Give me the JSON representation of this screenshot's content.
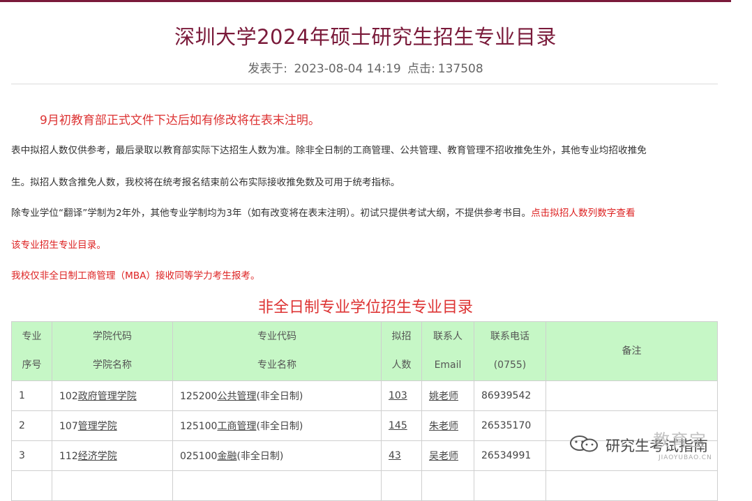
{
  "article": {
    "title": "深圳大学2024年硕士研究生招生专业目录",
    "meta_published_label": "发表于:",
    "meta_date": "2023-08-04 14:19",
    "meta_clicks_label": "点击:",
    "meta_clicks": "137508"
  },
  "notice": "9月初教育部正式文件下达后如有修改将在表末注明。",
  "paragraphs": {
    "p1": "表中拟招人数仅供参考，最后录取以教育部实际下达招生人数为准。除非全日制的工商管理、公共管理、教育管理不招收推免生外，其他专业均招收推免",
    "p2": "生。拟招人数含推免人数，我校将在统考报名结束前公布实际接收推免数及可用于统考指标。",
    "p3_normal": "除专业学位“翻译”学制为2年外，其他专业学制均为3年（如有改变将在表末注明）。初试只提供考试大纲，不提供参考书目。",
    "p3_red": "点击拟招人数列数字查看",
    "p4_red": "该专业招生专业目录。",
    "p5_red": "我校仅非全日制工商管理（MBA）接收同等学力考生报考。"
  },
  "section_title": "非全日制专业学位招生专业目录",
  "table": {
    "headers": {
      "seq_1": "专业",
      "seq_2": "序号",
      "college_1": "学院代码",
      "college_2": "学院名称",
      "major_1": "专业代码",
      "major_2": "专业名称",
      "plan_1": "拟招",
      "plan_2": "人数",
      "contact_1": "联系人",
      "contact_2": "Email",
      "phone_1": "联系电话",
      "phone_2": "(0755)",
      "remark": "备注"
    },
    "rows": [
      {
        "seq": "1",
        "college_code": "102",
        "college_name": "政府管理学院",
        "major_code": "125200",
        "major_name": "公共管理",
        "major_type": "(非全日制)",
        "plan": "103",
        "contact": "姚老师",
        "phone": "86939542",
        "remark": ""
      },
      {
        "seq": "2",
        "college_code": "107",
        "college_name": "管理学院",
        "major_code": "125100",
        "major_name": "工商管理",
        "major_type": "(非全日制)",
        "plan": "145",
        "contact": "朱老师",
        "phone": "26535170",
        "remark": ""
      },
      {
        "seq": "3",
        "college_code": "112",
        "college_name": "经济学院",
        "major_code": "025100",
        "major_name": "金融",
        "major_type": "(非全日制)",
        "plan": "43",
        "contact": "吴老师",
        "phone": "26534991",
        "remark": ""
      },
      {
        "seq": "",
        "college_code": "",
        "college_name": "",
        "major_code": "",
        "major_name": "",
        "major_type": "",
        "plan": "",
        "contact": "",
        "phone": "",
        "remark": ""
      }
    ]
  },
  "watermark": {
    "text": "研究生考试指南",
    "brand": "教育宝",
    "brand_sub": "JIAOYUBAO.CN"
  }
}
